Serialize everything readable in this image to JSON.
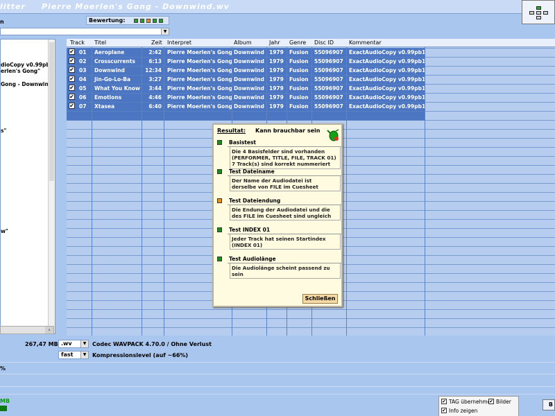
{
  "window": {
    "app_fragment": "litter",
    "title": "Pierre Moerlen's Gong - Downwind.wv"
  },
  "rating": {
    "label": "Bewertung:",
    "dots": [
      "#2b9a2b",
      "#2b9a2b",
      "#e6921f",
      "#2b9a2b",
      "#2b9a2b"
    ]
  },
  "left": {
    "label_fragment": "n",
    "tree_lines": [
      "dioCopy v0.99pb1",
      "erlen's Gong\"",
      "Gong - Downwind.w",
      "s\"",
      "w\""
    ]
  },
  "table": {
    "headers": [
      "Track",
      "Titel",
      "Zeit",
      "Interpret",
      "Album",
      "Jahr",
      "Genre",
      "Disc ID",
      "Kommentar"
    ],
    "rows": [
      {
        "checked": "✔",
        "track": "01",
        "title": "Aeroplane",
        "time": "2:42",
        "artist": "Pierre Moerlen's Gong",
        "album": "Downwind",
        "year": "1979",
        "genre": "Fusion",
        "discid": "55096907",
        "comment": "ExactAudioCopy v0.99pb1"
      },
      {
        "checked": "✔",
        "track": "02",
        "title": "Crosscurrents",
        "time": "6:13",
        "artist": "Pierre Moerlen's Gong",
        "album": "Downwind",
        "year": "1979",
        "genre": "Fusion",
        "discid": "55096907",
        "comment": "ExactAudioCopy v0.99pb1"
      },
      {
        "checked": "✔",
        "track": "03",
        "title": "Downwind",
        "time": "12:34",
        "artist": "Pierre Moerlen's Gong",
        "album": "Downwind",
        "year": "1979",
        "genre": "Fusion",
        "discid": "55096907",
        "comment": "ExactAudioCopy v0.99pb1"
      },
      {
        "checked": "✔",
        "track": "04",
        "title": "Jin-Go-Lo-Ba",
        "time": "3:27",
        "artist": "Pierre Moerlen's Gong",
        "album": "Downwind",
        "year": "1979",
        "genre": "Fusion",
        "discid": "55096907",
        "comment": "ExactAudioCopy v0.99pb1"
      },
      {
        "checked": "✔",
        "track": "05",
        "title": "What You Know",
        "time": "3:44",
        "artist": "Pierre Moerlen's Gong",
        "album": "Downwind",
        "year": "1979",
        "genre": "Fusion",
        "discid": "55096907",
        "comment": "ExactAudioCopy v0.99pb1"
      },
      {
        "checked": "✔",
        "track": "06",
        "title": "Emotions",
        "time": "4:46",
        "artist": "Pierre Moerlen's Gong",
        "album": "Downwind",
        "year": "1979",
        "genre": "Fusion",
        "discid": "55096907",
        "comment": "ExactAudioCopy v0.99pb1"
      },
      {
        "checked": "✔",
        "track": "07",
        "title": "Xtasea",
        "time": "6:40",
        "artist": "Pierre Moerlen's Gong",
        "album": "Downwind",
        "year": "1979",
        "genre": "Fusion",
        "discid": "55096907",
        "comment": "ExactAudioCopy v0.99pb1"
      }
    ]
  },
  "dialog": {
    "result_label": "Resultat:",
    "result_value": "Kann brauchbar sein",
    "sections": [
      {
        "color": "#1f8a1f",
        "title": "Basistest",
        "text": "Die 4 Basisfelder sind vorhanden\n(PERFORMER, TITLE, FILE, TRACK 01)\n7 Track(s) sind korrekt nummeriert"
      },
      {
        "color": "#1f8a1f",
        "title": "Test Dateiname",
        "text": "Der Name der Audiodatei ist\nderselbe von FILE im Cuesheet"
      },
      {
        "color": "#e6921f",
        "title": "Test Dateiendung",
        "text": "Die Endung der Audiodatei und die\ndes FILE im Cuesheet sind ungleich"
      },
      {
        "color": "#1f8a1f",
        "title": "Test INDEX 01",
        "text": "Jeder Track hat seinen Startindex\n(INDEX 01)"
      },
      {
        "color": "#1f8a1f",
        "title": "Test Audiolänge",
        "text": "Die Audiolänge scheint passend zu\nsein"
      }
    ],
    "close_label": "Schließen"
  },
  "bottom": {
    "size": "267,47 MB",
    "format_value": ".wv",
    "codec": "Codec WAVPACK 4.70.0 / Ohne Verlust",
    "speed_value": "fast",
    "compression": "Kompressionslevel (auf ~66%)",
    "percent_fragment": "%",
    "mb_fragment": "MB",
    "options": {
      "tag": {
        "checked": "✔",
        "label": "TAG übernehmen"
      },
      "images": {
        "checked": "✔",
        "label": "Bilder"
      },
      "info": {
        "checked": "✔",
        "label": "Info zeigen"
      }
    },
    "right_button_fragment": "B"
  }
}
